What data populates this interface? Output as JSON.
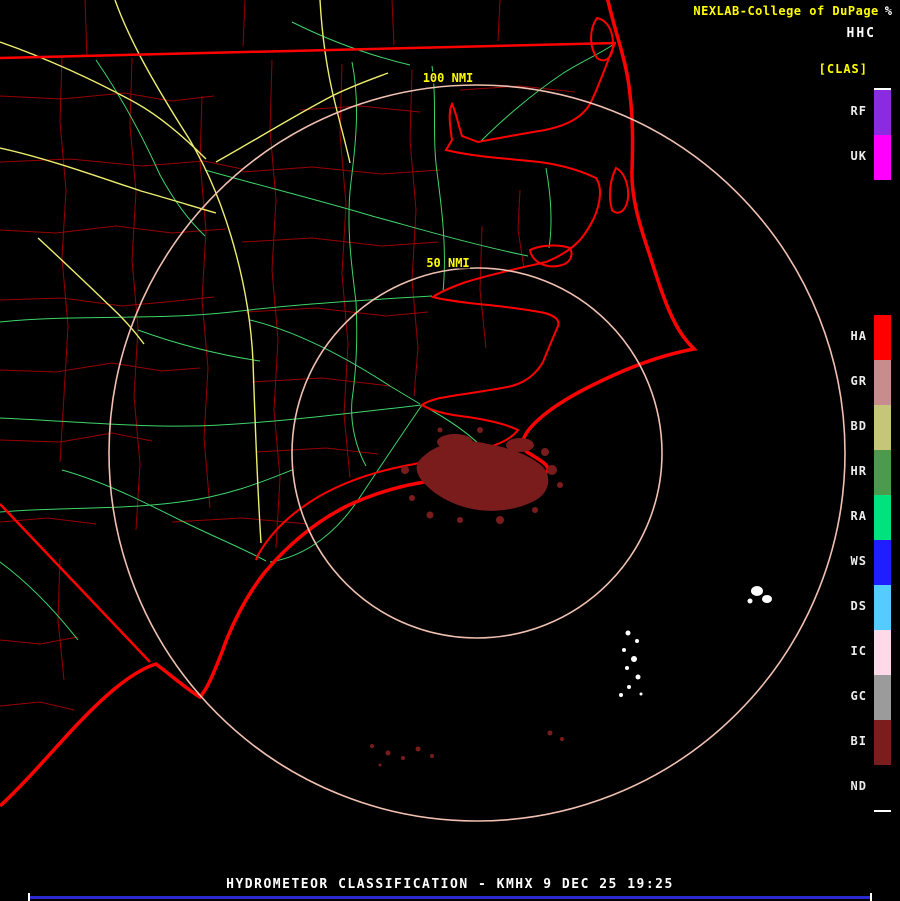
{
  "header": {
    "brand": "NEXLAB-College of DuPage",
    "product_code": "HHC",
    "product_tag": "[CLAS]",
    "logo_glyph": "%"
  },
  "colors": {
    "brand": "#FFFF00",
    "product_code": "#FFFFFF",
    "product_tag": "#FFFF00",
    "legend_label": "#ECECEC",
    "ring": "#F0C0B0",
    "ring_label": "#FFFF00",
    "coast": "#FF0000",
    "county": "#A00000",
    "road_primary": "#EDED6E",
    "road_secondary": "#3FD46A",
    "echo_biological": "#7A1C1C",
    "echo_snow": "#FFFFFF",
    "status_text": "#FFFFFF",
    "status_line": "#2A2AD0"
  },
  "legend": {
    "entries": [
      {
        "label": "RF",
        "color": "#8A2BE2"
      },
      {
        "label": "UK",
        "color": "#FF00FF"
      },
      {
        "label": "",
        "color": "#000000"
      },
      {
        "label": "",
        "color": "#000000"
      },
      {
        "label": "",
        "color": "#000000"
      },
      {
        "label": "HA",
        "color": "#FF0000"
      },
      {
        "label": "GR",
        "color": "#C88C8C"
      },
      {
        "label": "BD",
        "color": "#C6C67A"
      },
      {
        "label": "HR",
        "color": "#4C9B4C"
      },
      {
        "label": "RA",
        "color": "#00E27E"
      },
      {
        "label": "WS",
        "color": "#1E1EFF"
      },
      {
        "label": "DS",
        "color": "#55CCFF"
      },
      {
        "label": "IC",
        "color": "#FFD9E8"
      },
      {
        "label": "GC",
        "color": "#9B9B9B"
      },
      {
        "label": "BI",
        "color": "#7C1D1D"
      },
      {
        "label": "ND",
        "color": "#000000"
      }
    ]
  },
  "map": {
    "range_rings": [
      {
        "label": "100 NMI"
      },
      {
        "label": "50 NMI"
      }
    ]
  },
  "status_bar": {
    "text": "HYDROMETEOR CLASSIFICATION - KMHX 9 DEC 25 19:25"
  }
}
